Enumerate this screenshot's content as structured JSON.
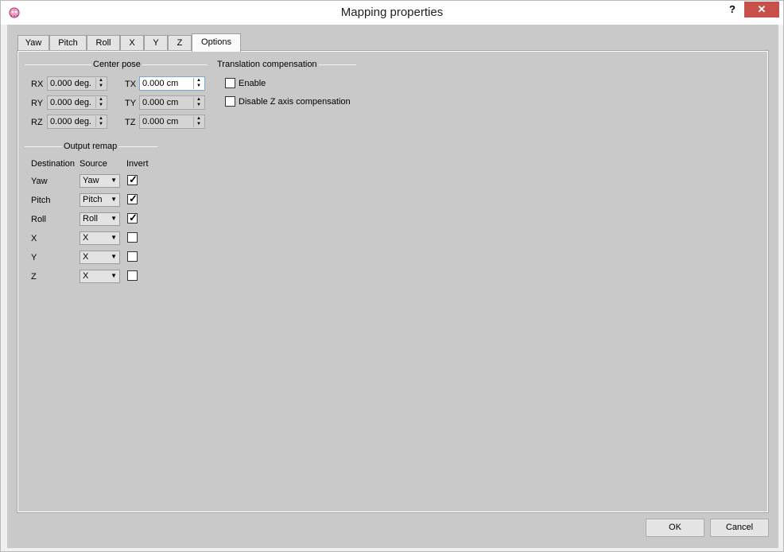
{
  "window": {
    "title": "Mapping properties",
    "help": "?",
    "close": "✕"
  },
  "tabs": [
    {
      "label": "Yaw"
    },
    {
      "label": "Pitch"
    },
    {
      "label": "Roll"
    },
    {
      "label": "X"
    },
    {
      "label": "Y"
    },
    {
      "label": "Z"
    },
    {
      "label": "Options",
      "active": true
    }
  ],
  "center_pose": {
    "title": "Center pose",
    "rows": [
      {
        "rlabel": "RX",
        "rvalue": "0.000 deg.",
        "tlabel": "TX",
        "tvalue": "0.000 cm"
      },
      {
        "rlabel": "RY",
        "rvalue": "0.000 deg.",
        "tlabel": "TY",
        "tvalue": "0.000 cm"
      },
      {
        "rlabel": "RZ",
        "rvalue": "0.000 deg.",
        "tlabel": "TZ",
        "tvalue": "0.000 cm"
      }
    ]
  },
  "translation_compensation": {
    "title": "Translation compensation",
    "enable": {
      "label": "Enable",
      "checked": false
    },
    "disable_z": {
      "label": "Disable Z axis compensation",
      "checked": false
    }
  },
  "output_remap": {
    "title": "Output remap",
    "headers": {
      "destination": "Destination",
      "source": "Source",
      "invert": "Invert"
    },
    "rows": [
      {
        "destination": "Yaw",
        "source": "Yaw",
        "invert": true
      },
      {
        "destination": "Pitch",
        "source": "Pitch",
        "invert": true
      },
      {
        "destination": "Roll",
        "source": "Roll",
        "invert": true
      },
      {
        "destination": "X",
        "source": "X",
        "invert": false
      },
      {
        "destination": "Y",
        "source": "X",
        "invert": false
      },
      {
        "destination": "Z",
        "source": "X",
        "invert": false
      }
    ]
  },
  "buttons": {
    "ok": "OK",
    "cancel": "Cancel"
  },
  "colors": {
    "close": "#c7504b",
    "client": "#c9c9c9"
  }
}
